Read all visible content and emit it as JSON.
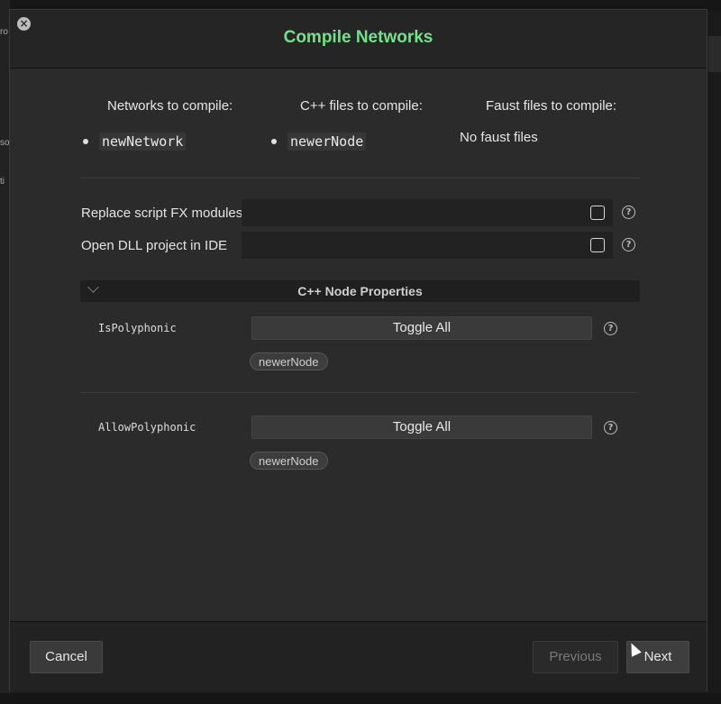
{
  "dialog": {
    "title": "Compile Networks"
  },
  "background": {
    "left_fragments": [
      "ro",
      "so",
      "ti"
    ]
  },
  "summary": {
    "networks_heading": "Networks to compile:",
    "cpp_heading": "C++ files to compile:",
    "faust_heading": "Faust files to compile:",
    "networks": [
      "newNetwork"
    ],
    "cpp_files": [
      "newerNode"
    ],
    "faust_empty": "No faust files"
  },
  "options": [
    {
      "label": "Replace script FX modules",
      "checked": false
    },
    {
      "label": "Open DLL project in IDE",
      "checked": false
    }
  ],
  "node_properties": {
    "title": "C++ Node Properties",
    "props": [
      {
        "name": "IsPolyphonic",
        "toggle_label": "Toggle All",
        "nodes": [
          "newerNode"
        ]
      },
      {
        "name": "AllowPolyphonic",
        "toggle_label": "Toggle All",
        "nodes": [
          "newerNode"
        ]
      }
    ]
  },
  "footer": {
    "cancel": "Cancel",
    "previous": "Previous",
    "next": "Next"
  },
  "colors": {
    "title_accent": "#73e08a",
    "dialog_bg": "#2b2b2b"
  },
  "icons": {
    "close": "close-icon",
    "help": "help-icon",
    "collapse": "chevron-down-icon"
  }
}
